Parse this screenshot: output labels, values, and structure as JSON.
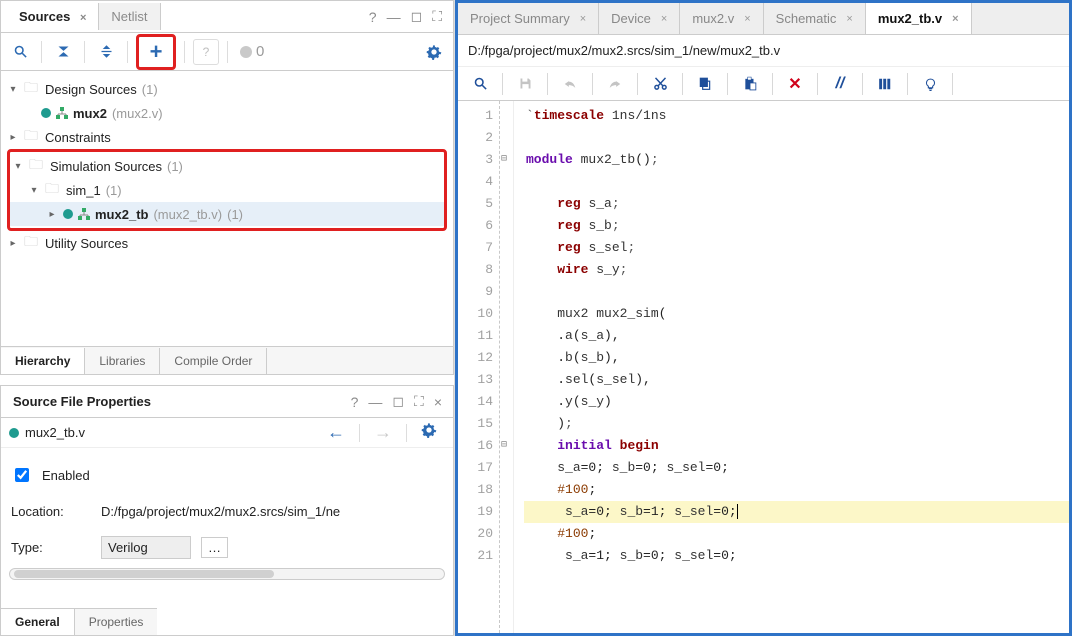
{
  "sources_panel": {
    "tabs": {
      "sources": "Sources",
      "netlist": "Netlist"
    },
    "header_controls": {
      "help": "?",
      "min": "—",
      "restore": "❐",
      "max": "🗖"
    },
    "toolbar": {
      "search": "🔍",
      "collapse": "⇱",
      "updown": "⇳",
      "add": "＋",
      "unknown": "?",
      "dot_count": "0",
      "gear": "⚙"
    },
    "tree": {
      "design_sources": {
        "label": "Design Sources",
        "count": "(1)"
      },
      "mux2": {
        "label": "mux2",
        "file": "(mux2.v)"
      },
      "constraints": {
        "label": "Constraints"
      },
      "sim_sources": {
        "label": "Simulation Sources",
        "count": "(1)"
      },
      "sim_1": {
        "label": "sim_1",
        "count": "(1)"
      },
      "mux2_tb": {
        "label": "mux2_tb",
        "file": "(mux2_tb.v)",
        "extra": "(1)"
      },
      "utility": {
        "label": "Utility Sources"
      }
    },
    "bottom_tabs": {
      "hierarchy": "Hierarchy",
      "libraries": "Libraries",
      "compile": "Compile Order"
    }
  },
  "sfp": {
    "title": "Source File Properties",
    "file": "mux2_tb.v",
    "enabled_label": "Enabled",
    "location_label": "Location:",
    "location_value": "D:/fpga/project/mux2/mux2.srcs/sim_1/ne",
    "type_label": "Type:",
    "type_value": "Verilog",
    "bottom_tabs": {
      "general": "General",
      "properties": "Properties"
    }
  },
  "right": {
    "tabs": {
      "summary": "Project Summary",
      "device": "Device",
      "mux2": "mux2.v",
      "schematic": "Schematic",
      "tb": "mux2_tb.v"
    },
    "path": "D:/fpga/project/mux2/mux2.srcs/sim_1/new/mux2_tb.v",
    "code_lines": [
      {
        "n": 1,
        "pre": "",
        "html": "<span class='tok-punc'>`</span><span class='tok-kw'>timescale</span> <span class='tok-id'>1ns/1ns</span>"
      },
      {
        "n": 2,
        "pre": "",
        "html": ""
      },
      {
        "n": 3,
        "pre": "",
        "html": "<span class='tok-kw2'>module</span> <span class='tok-id'>mux2_tb</span>()<span class='tok-punc'>;</span>",
        "fold": "⊟"
      },
      {
        "n": 4,
        "pre": "",
        "html": ""
      },
      {
        "n": 5,
        "pre": "    ",
        "html": "<span class='tok-kw'>reg</span> <span class='tok-id'>s_a</span><span class='tok-punc'>;</span>"
      },
      {
        "n": 6,
        "pre": "    ",
        "html": "<span class='tok-kw'>reg</span> <span class='tok-id'>s_b</span><span class='tok-punc'>;</span>"
      },
      {
        "n": 7,
        "pre": "    ",
        "html": "<span class='tok-kw'>reg</span> <span class='tok-id'>s_sel</span><span class='tok-punc'>;</span>"
      },
      {
        "n": 8,
        "pre": "    ",
        "html": "<span class='tok-kw'>wire</span> <span class='tok-id'>s_y</span><span class='tok-punc'>;</span>"
      },
      {
        "n": 9,
        "pre": "",
        "html": ""
      },
      {
        "n": 10,
        "pre": "    ",
        "html": "<span class='tok-id'>mux2 mux2_sim</span>("
      },
      {
        "n": 11,
        "pre": "    ",
        "html": ".<span class='tok-id'>a</span>(<span class='tok-id'>s_a</span>),"
      },
      {
        "n": 12,
        "pre": "    ",
        "html": ".<span class='tok-id'>b</span>(<span class='tok-id'>s_b</span>),"
      },
      {
        "n": 13,
        "pre": "    ",
        "html": ".<span class='tok-id'>sel</span>(<span class='tok-id'>s_sel</span>),"
      },
      {
        "n": 14,
        "pre": "    ",
        "html": ".<span class='tok-id'>y</span>(<span class='tok-id'>s_y</span>)"
      },
      {
        "n": 15,
        "pre": "    ",
        "html": ")<span class='tok-punc'>;</span>"
      },
      {
        "n": 16,
        "pre": "    ",
        "html": "<span class='tok-kw2'>initial</span> <span class='tok-kw'>begin</span>",
        "fold": "⊟"
      },
      {
        "n": 17,
        "pre": "    ",
        "html": "<span class='tok-id'>s_a</span>=0; <span class='tok-id'>s_b</span>=0; <span class='tok-id'>s_sel</span>=0;"
      },
      {
        "n": 18,
        "pre": "    ",
        "html": "<span class='tok-dir'>#100</span>;"
      },
      {
        "n": 19,
        "pre": "     ",
        "html": "<span class='tok-id'>s_a</span>=0; <span class='tok-id'>s_b</span>=1; <span class='tok-id'>s_sel</span>=0;<span class='caret'></span>",
        "hl": true
      },
      {
        "n": 20,
        "pre": "    ",
        "html": "<span class='tok-dir'>#100</span>;"
      },
      {
        "n": 21,
        "pre": "     ",
        "html": "<span class='tok-id'>s_a</span>=1; <span class='tok-id'>s_b</span>=0; <span class='tok-id'>s_sel</span>=0;"
      }
    ]
  }
}
